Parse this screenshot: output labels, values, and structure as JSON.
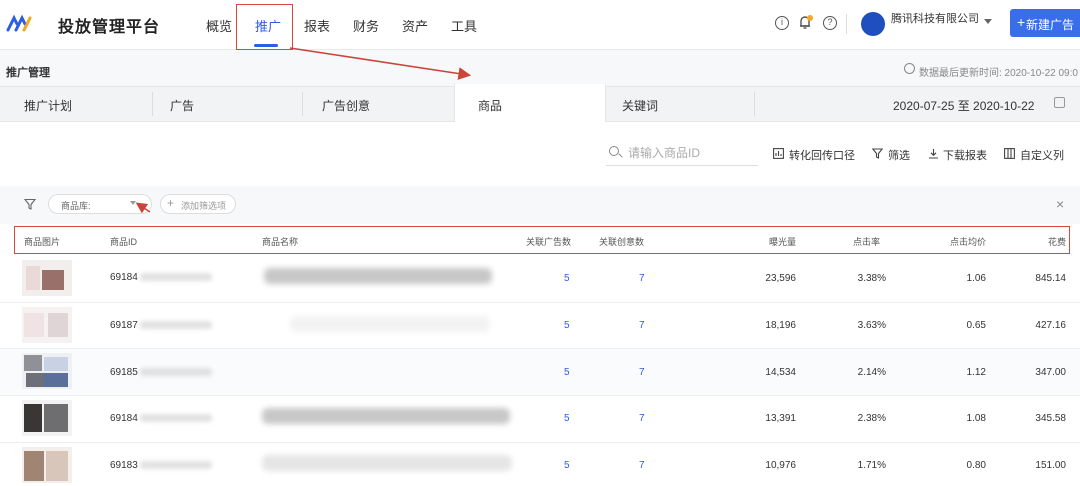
{
  "app": {
    "title": "投放管理平台"
  },
  "nav": [
    {
      "label": "概览",
      "active": false
    },
    {
      "label": "推广",
      "active": true
    },
    {
      "label": "报表",
      "active": false
    },
    {
      "label": "财务",
      "active": false
    },
    {
      "label": "资产",
      "active": false
    },
    {
      "label": "工具",
      "active": false
    }
  ],
  "header": {
    "info_icon": "i",
    "help_icon": "?",
    "company": "腾讯科技有限公司",
    "new_ad_label": "新建广告",
    "new_ad_plus": "+"
  },
  "page": {
    "title": "推广管理",
    "last_updated": "数据最后更新时间: 2020-10-22 09:0"
  },
  "tabs": [
    {
      "label": "推广计划",
      "active": false
    },
    {
      "label": "广告",
      "active": false
    },
    {
      "label": "广告创意",
      "active": false
    },
    {
      "label": "商品",
      "active": true
    },
    {
      "label": "关键词",
      "active": false
    }
  ],
  "date_range": "2020-07-25 至 2020-10-22",
  "toolbar": {
    "search_placeholder": "请输入商品ID",
    "conversion_label": "转化回传口径",
    "filter_label": "筛选",
    "download_label": "下载报表",
    "columns_label": "自定义列"
  },
  "filters": {
    "library_label": "商品库:",
    "add_filter_label": "添加筛选项",
    "add_filter_plus": "+",
    "close": "×"
  },
  "table": {
    "columns": [
      "商品图片",
      "商品ID",
      "商品名称",
      "关联广告数",
      "关联创意数",
      "曝光量",
      "点击率",
      "点击均价",
      "花费"
    ],
    "rows": [
      {
        "id_prefix": "69184",
        "ads": "5",
        "creatives": "7",
        "impressions": "23,596",
        "ctr": "3.38%",
        "cpc": "1.06",
        "cost": "845.14"
      },
      {
        "id_prefix": "69187",
        "ads": "5",
        "creatives": "7",
        "impressions": "18,196",
        "ctr": "3.63%",
        "cpc": "0.65",
        "cost": "427.16"
      },
      {
        "id_prefix": "69185",
        "ads": "5",
        "creatives": "7",
        "impressions": "14,534",
        "ctr": "2.14%",
        "cpc": "1.12",
        "cost": "347.00"
      },
      {
        "id_prefix": "69184",
        "ads": "5",
        "creatives": "7",
        "impressions": "13,391",
        "ctr": "2.38%",
        "cpc": "1.08",
        "cost": "345.58"
      },
      {
        "id_prefix": "69183",
        "ads": "5",
        "creatives": "7",
        "impressions": "10,976",
        "ctr": "1.71%",
        "cpc": "0.80",
        "cost": "151.00"
      }
    ]
  },
  "colors": {
    "accent": "#2d5ce6",
    "annotation": "#d9473b"
  }
}
